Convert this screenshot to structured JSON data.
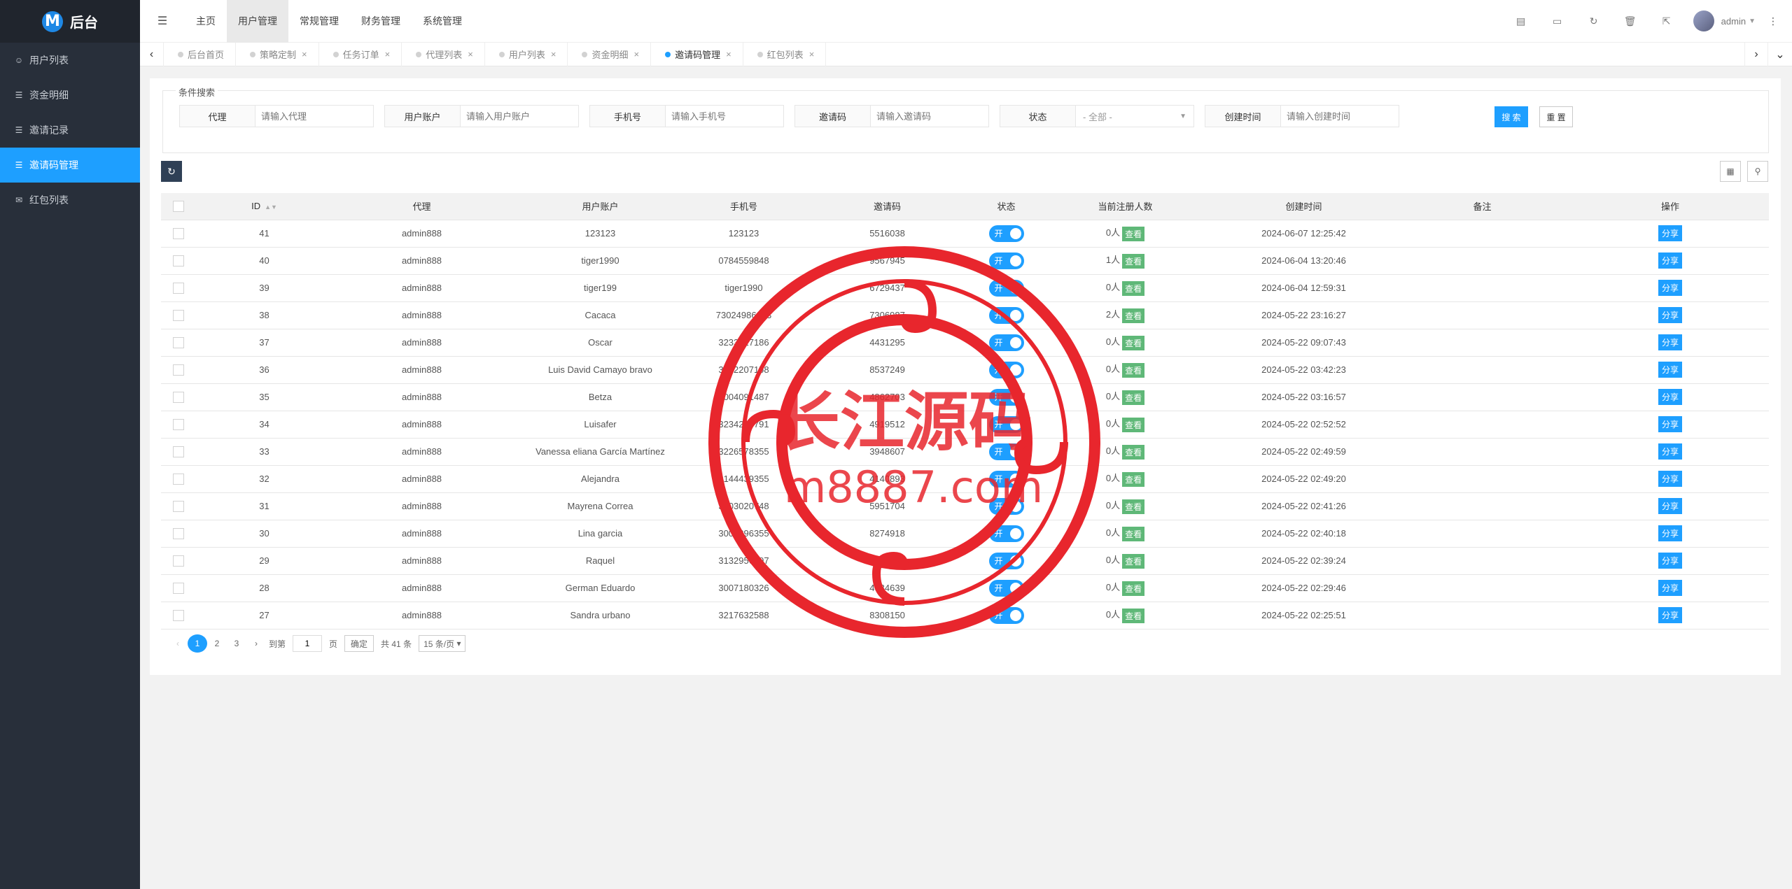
{
  "logo": {
    "letter": "M",
    "title": "后台"
  },
  "sidebar": {
    "items": [
      {
        "label": "用户列表",
        "icon": "users-icon"
      },
      {
        "label": "资金明细",
        "icon": "list-icon"
      },
      {
        "label": "邀请记录",
        "icon": "list-icon"
      },
      {
        "label": "邀请码管理",
        "icon": "list-icon",
        "active": true
      },
      {
        "label": "红包列表",
        "icon": "envelope-icon"
      }
    ]
  },
  "header": {
    "nav": [
      "主页",
      "用户管理",
      "常规管理",
      "财务管理",
      "系统管理"
    ],
    "active_nav": "用户管理",
    "user": "admin"
  },
  "tabs": [
    "后台首页",
    "策略定制",
    "任务订单",
    "代理列表",
    "用户列表",
    "资金明细",
    "邀请码管理",
    "红包列表"
  ],
  "active_tab": "邀请码管理",
  "search": {
    "legend": "条件搜索",
    "fields": [
      {
        "label": "代理",
        "placeholder": "请输入代理"
      },
      {
        "label": "用户账户",
        "placeholder": "请输入用户账户"
      },
      {
        "label": "手机号",
        "placeholder": "请输入手机号"
      },
      {
        "label": "邀请码",
        "placeholder": "请输入邀请码"
      },
      {
        "label": "状态",
        "value": "- 全部 -"
      },
      {
        "label": "创建时间",
        "placeholder": "请输入创建时间"
      }
    ],
    "search_btn": "搜 索",
    "reset_btn": "重 置"
  },
  "table": {
    "headers": [
      "ID",
      "代理",
      "用户账户",
      "手机号",
      "邀请码",
      "状态",
      "当前注册人数",
      "创建时间",
      "备注",
      "操作"
    ],
    "rows": [
      {
        "id": "41",
        "agent": "admin888",
        "account": "123123",
        "phone": "123123",
        "code": "5516038",
        "status": "开",
        "count": "0人",
        "created": "2024-06-07 12:25:42"
      },
      {
        "id": "40",
        "agent": "admin888",
        "account": "tiger1990",
        "phone": "0784559848",
        "code": "9567945",
        "status": "开",
        "count": "1人",
        "created": "2024-06-04 13:20:46"
      },
      {
        "id": "39",
        "agent": "admin888",
        "account": "tiger199",
        "phone": "tiger1990",
        "code": "6729437",
        "status": "开",
        "count": "0人",
        "created": "2024-06-04 12:59:31"
      },
      {
        "id": "38",
        "agent": "admin888",
        "account": "Cacaca",
        "phone": "73024986233",
        "code": "7306987",
        "status": "开",
        "count": "2人",
        "created": "2024-05-22 23:16:27"
      },
      {
        "id": "37",
        "agent": "admin888",
        "account": "Oscar",
        "phone": "3233217186",
        "code": "4431295",
        "status": "开",
        "count": "0人",
        "created": "2024-05-22 09:07:43"
      },
      {
        "id": "36",
        "agent": "admin888",
        "account": "Luis David Camayo bravo",
        "phone": "3132207158",
        "code": "8537249",
        "status": "开",
        "count": "0人",
        "created": "2024-05-22 03:42:23"
      },
      {
        "id": "35",
        "agent": "admin888",
        "account": "Betza",
        "phone": "3004091487",
        "code": "4862703",
        "status": "开",
        "count": "0人",
        "created": "2024-05-22 03:16:57"
      },
      {
        "id": "34",
        "agent": "admin888",
        "account": "Luisafer",
        "phone": "3234267791",
        "code": "4919512",
        "status": "开",
        "count": "0人",
        "created": "2024-05-22 02:52:52"
      },
      {
        "id": "33",
        "agent": "admin888",
        "account": "Vanessa eliana García Martínez",
        "phone": "3226578355",
        "code": "3948607",
        "status": "开",
        "count": "0人",
        "created": "2024-05-22 02:49:59"
      },
      {
        "id": "32",
        "agent": "admin888",
        "account": "Alejandra",
        "phone": "3144439355",
        "code": "4140893",
        "status": "开",
        "count": "0人",
        "created": "2024-05-22 02:49:20"
      },
      {
        "id": "31",
        "agent": "admin888",
        "account": "Mayrena Correa",
        "phone": "3103020748",
        "code": "5951704",
        "status": "开",
        "count": "0人",
        "created": "2024-05-22 02:41:26"
      },
      {
        "id": "30",
        "agent": "admin888",
        "account": "Lina garcia",
        "phone": "3008896355",
        "code": "8274918",
        "status": "开",
        "count": "0人",
        "created": "2024-05-22 02:40:18"
      },
      {
        "id": "29",
        "agent": "admin888",
        "account": "Raquel",
        "phone": "3132956497",
        "code": "7017932",
        "status": "开",
        "count": "0人",
        "created": "2024-05-22 02:39:24"
      },
      {
        "id": "28",
        "agent": "admin888",
        "account": "German Eduardo",
        "phone": "3007180326",
        "code": "4784639",
        "status": "开",
        "count": "0人",
        "created": "2024-05-22 02:29:46"
      },
      {
        "id": "27",
        "agent": "admin888",
        "account": "Sandra urbano",
        "phone": "3217632588",
        "code": "8308150",
        "status": "开",
        "count": "0人",
        "created": "2024-05-22 02:25:51"
      }
    ],
    "view_label": "查看",
    "share_label": "分享"
  },
  "pagination": {
    "pages": [
      "1",
      "2",
      "3"
    ],
    "current": "1",
    "goto_label": "到第",
    "goto_value": "1",
    "page_unit": "页",
    "confirm": "确定",
    "total": "共 41 条",
    "per_page": "15 条/页"
  },
  "watermark": {
    "title": "长江源码",
    "url": "m8887.com",
    "color": "#e8262d"
  }
}
